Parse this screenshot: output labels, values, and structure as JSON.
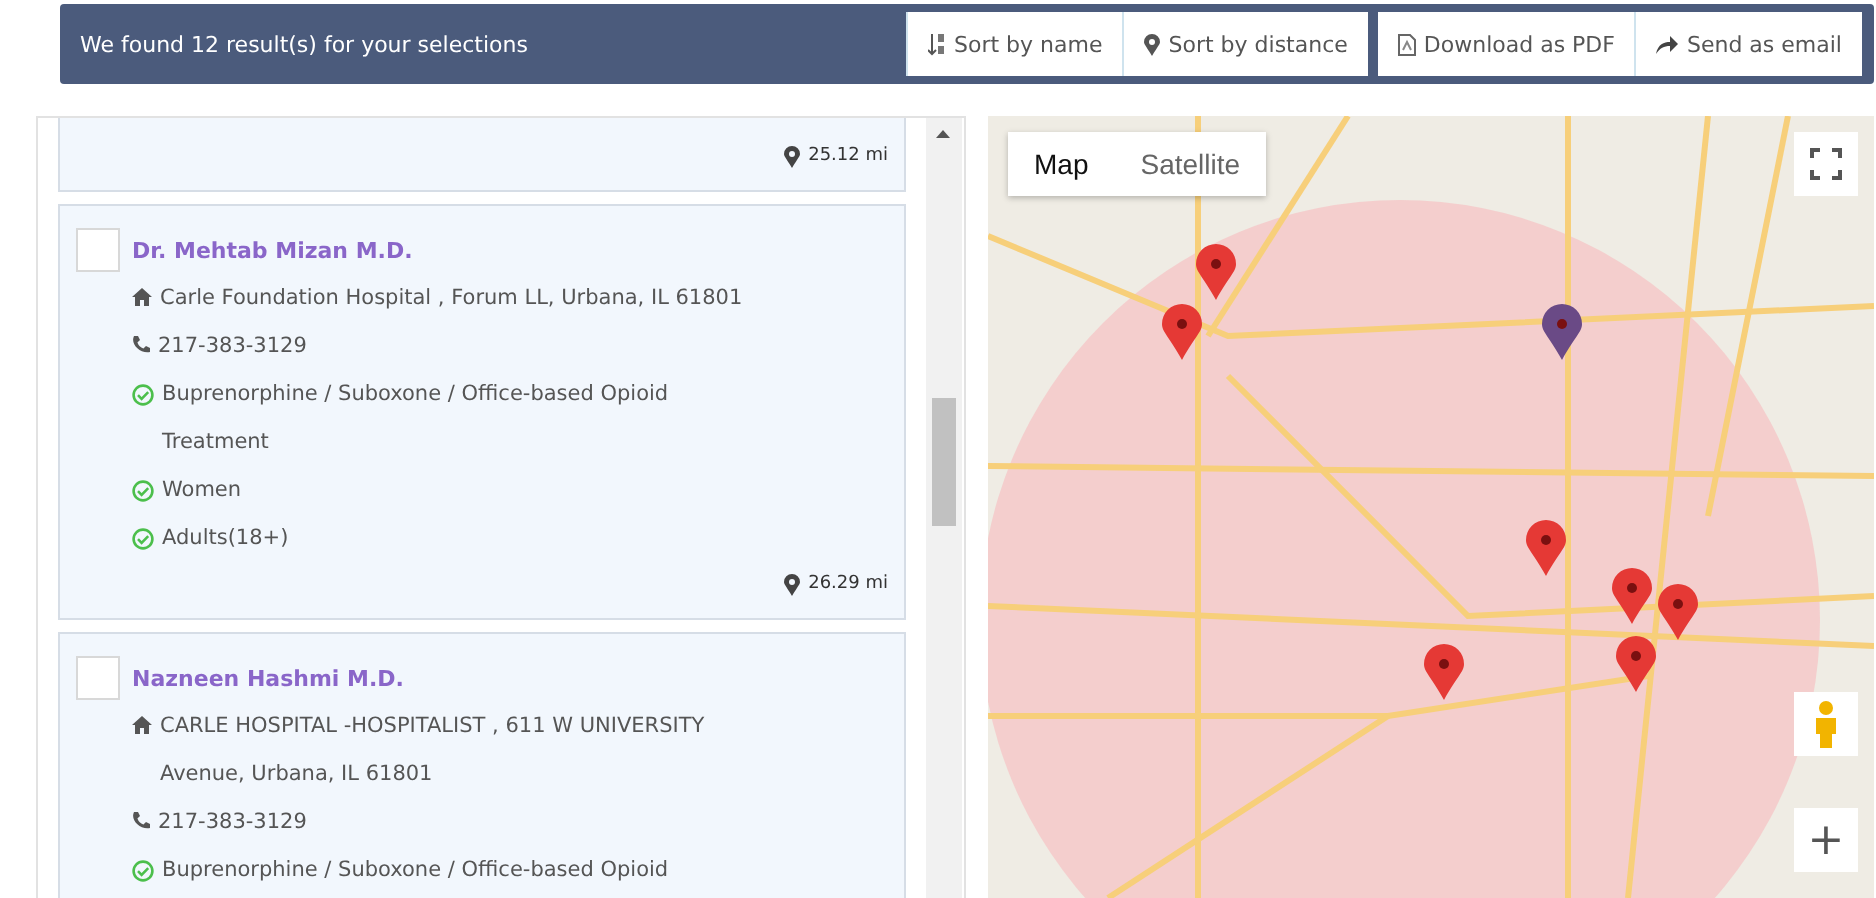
{
  "header": {
    "summary": "We found 12 result(s) for your selections",
    "buttons": [
      {
        "label": "Sort by name"
      },
      {
        "label": "Sort by distance"
      },
      {
        "label": "Download as PDF"
      },
      {
        "label": "Send as email"
      }
    ]
  },
  "results": [
    {
      "distance": "25.12 mi"
    },
    {
      "checked": false,
      "name": "Dr. Mehtab Mizan M.D.",
      "address": "Carle Foundation Hospital , Forum LL, Urbana, IL 61801",
      "phone": "217-383-3129",
      "services": [
        "Buprenorphine / Suboxone / Office-based Opioid Treatment",
        "Women",
        "Adults(18+)"
      ],
      "distance": "26.29 mi"
    },
    {
      "checked": false,
      "name": "Nazneen Hashmi M.D.",
      "address": "CARLE HOSPITAL -HOSPITALIST , 611 W UNIVERSITY Avenue, Urbana, IL 61801",
      "phone": "217-383-3129",
      "services": [
        "Buprenorphine / Suboxone / Office-based Opioid"
      ]
    }
  ],
  "map": {
    "map_types": [
      {
        "label": "Map",
        "selected": true
      },
      {
        "label": "Satellite",
        "selected": false
      }
    ],
    "zoom_in": "+"
  }
}
